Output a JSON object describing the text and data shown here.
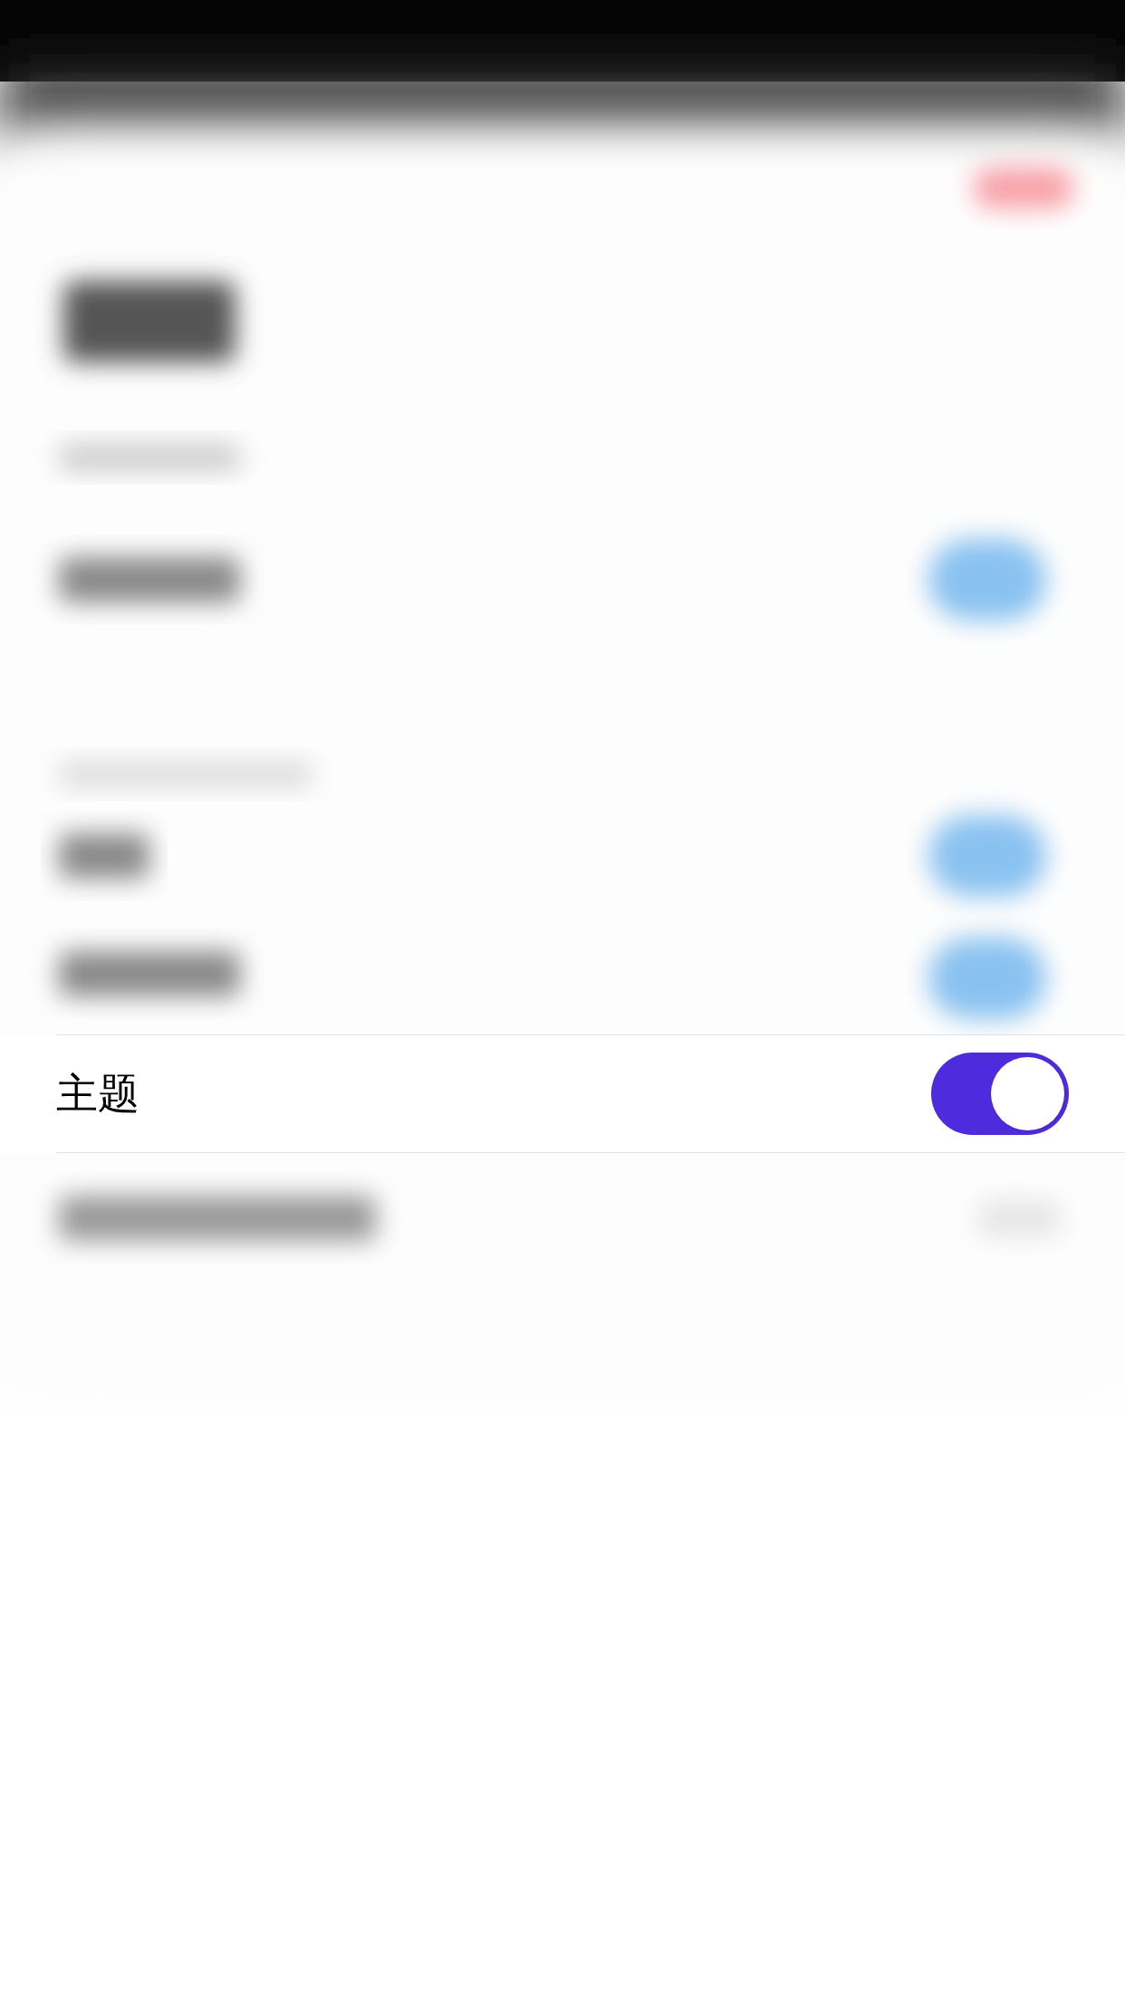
{
  "setting": {
    "label": "主题",
    "on": true
  }
}
